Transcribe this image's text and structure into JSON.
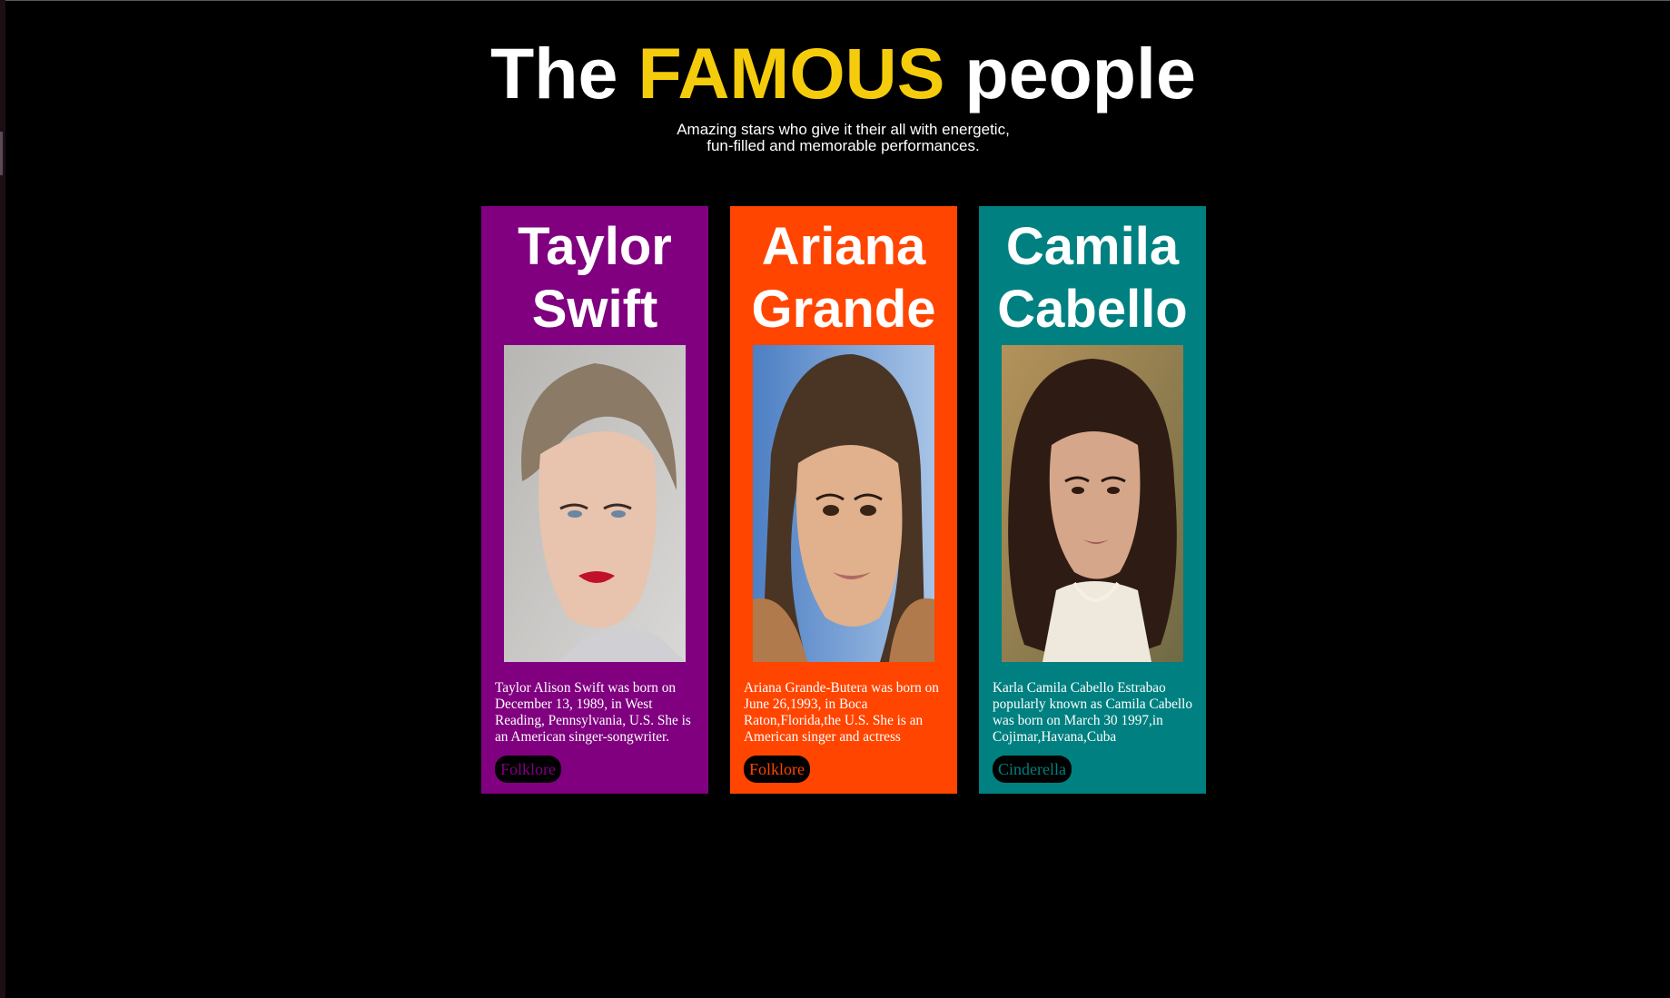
{
  "header": {
    "title_prefix": "The ",
    "title_highlight": "FAMOUS",
    "title_suffix": " people",
    "subtitle": "Amazing stars who give it their all with energetic, fun-filled and memorable performances."
  },
  "colors": {
    "background": "#000000",
    "highlight": "#f5cc0c",
    "card_1": "#800080",
    "card_2": "#ff4500",
    "card_3": "#008080"
  },
  "cards": [
    {
      "name": "Taylor Swift",
      "image": "taylor-swift-photo",
      "bio": "Taylor Alison Swift was born on December 13, 1989, in West Reading, Pennsylvania, U.S. She is an American singer-songwriter.",
      "button": "Folklore"
    },
    {
      "name": "Ariana Grande",
      "image": "ariana-grande-photo",
      "bio": "Ariana Grande-Butera was born on June 26,1993, in Boca Raton,Florida,the U.S. She is an American singer and actress",
      "button": "Folklore"
    },
    {
      "name": "Camila Cabello",
      "image": "camila-cabello-photo",
      "bio": "Karla Camila Cabello Estrabao popularly known as Camila Cabello was born on March 30 1997,in Cojimar,Havana,Cuba",
      "button": "Cinderella"
    }
  ]
}
